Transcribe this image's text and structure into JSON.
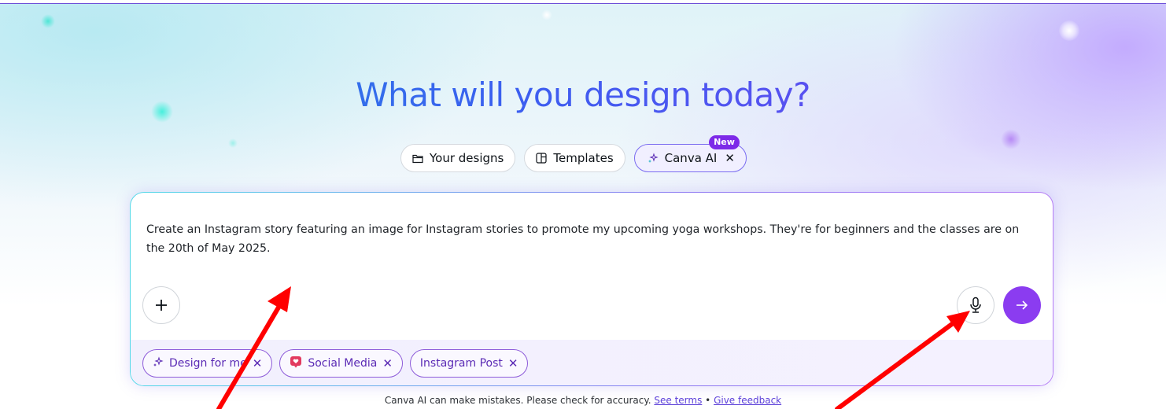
{
  "hero": {
    "headline": "What will you design today?"
  },
  "tabs": [
    {
      "label": "Your designs",
      "icon": "folder-icon"
    },
    {
      "label": "Templates",
      "icon": "template-icon"
    },
    {
      "label": "Canva AI",
      "icon": "sparkle-icon",
      "badge": "New",
      "active": true
    }
  ],
  "prompt": {
    "text": "Create an Instagram story featuring an image for Instagram stories to promote my upcoming yoga workshops. They're for beginners and the classes are on the 20th of May 2025."
  },
  "chips": [
    {
      "label": "Design for me",
      "icon": "sparkle-icon"
    },
    {
      "label": "Social Media",
      "icon": "heart-chat-icon"
    },
    {
      "label": "Instagram Post",
      "icon": ""
    }
  ],
  "footer": {
    "note": "Canva AI can make mistakes. Please check for accuracy.",
    "see_terms": "See terms",
    "separator": "•",
    "give_feedback": "Give feedback"
  },
  "colors": {
    "accent": "#8b3cf0",
    "annotation_arrow": "#ff0000"
  }
}
